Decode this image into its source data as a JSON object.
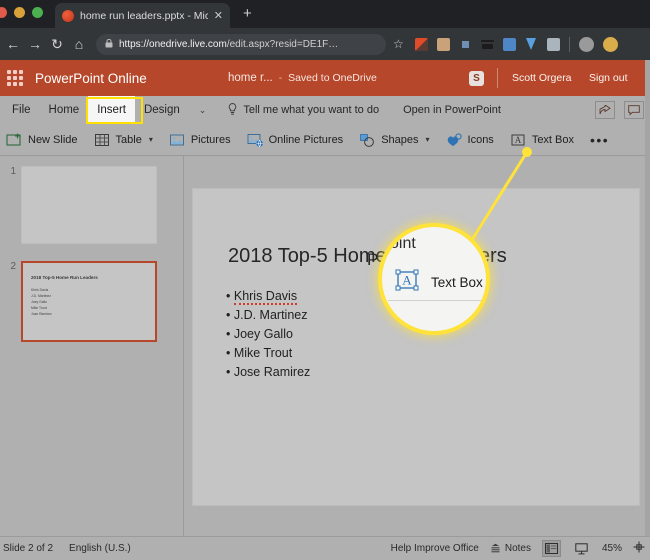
{
  "browser": {
    "tab": {
      "title": "home run leaders.pptx - Micro",
      "close_label": "✕",
      "favicon": "powerpoint-favicon"
    },
    "new_tab_label": "+",
    "nav": {
      "back": "←",
      "forward": "→",
      "reload": "↻",
      "home": "⌂"
    },
    "omnibox": {
      "lock": "🔒",
      "url_strong": "https://onedrive.live.com",
      "url_rest": "/edit.aspx?resid=DE1F…",
      "star": "☆"
    },
    "extensions": [
      "ext-pocket-icon",
      "ext-box-icon",
      "ext-square-icon",
      "ext-layers-icon",
      "ext-save-icon",
      "ext-shield-icon",
      "ext-image-icon"
    ],
    "profile_avatar": "profile-avatar",
    "second_avatar": "secondary-avatar"
  },
  "header": {
    "waffle": "app-launcher-icon",
    "brand": "PowerPoint Online",
    "doc_name": "home r...",
    "dash": "-",
    "save_state": "Saved to OneDrive",
    "skype_badge": "S",
    "user": "Scott Orgera",
    "sign_out": "Sign out",
    "accent": "#b7472a"
  },
  "ribbon": {
    "tabs": [
      {
        "label": "File",
        "active": false
      },
      {
        "label": "Home",
        "active": false
      },
      {
        "label": "Insert",
        "active": true
      },
      {
        "label": "Design",
        "active": false
      }
    ],
    "more_caret": "⌄",
    "tellme": "Tell me what you want to do",
    "tellme_icon": "lightbulb-icon",
    "open_in_powerpoint": "Open in PowerPoint",
    "share_icon": "share-icon",
    "comment_icon": "comment-icon",
    "highlight_color": "#ffe000",
    "commands": [
      {
        "label": "New Slide",
        "icon": "new-slide-icon",
        "caret": false
      },
      {
        "label": "Table",
        "icon": "table-icon",
        "caret": true
      },
      {
        "label": "Pictures",
        "icon": "pictures-icon",
        "caret": false
      },
      {
        "label": "Online Pictures",
        "icon": "online-pictures-icon",
        "caret": false
      },
      {
        "label": "Shapes",
        "icon": "shapes-icon",
        "caret": true
      },
      {
        "label": "Icons",
        "icon": "icons-icon",
        "caret": false
      },
      {
        "label": "Text Box",
        "icon": "text-box-icon",
        "caret": false
      }
    ],
    "overflow": "•••"
  },
  "thumbnails": [
    {
      "number": "1",
      "selected": false,
      "title": "",
      "bullets": []
    },
    {
      "number": "2",
      "selected": true,
      "title": "2018 Top-5 Home Run Leaders",
      "bullets": [
        "Khris Davis",
        "J.D. Martinez",
        "Joey Gallo",
        "Mike Trout",
        "Jose Ramirez"
      ]
    }
  ],
  "slide": {
    "title": "2018 Top-5 Home Run Leaders",
    "bullets": [
      {
        "text": "Khris Davis",
        "misspelled": true
      },
      {
        "text": "J.D. Martinez",
        "misspelled": false
      },
      {
        "text": "Joey Gallo",
        "misspelled": false
      },
      {
        "text": "Mike Trout",
        "misspelled": false
      },
      {
        "text": "Jose Ramirez",
        "misspelled": false
      }
    ]
  },
  "callout": {
    "ghost_text": "oint",
    "ghost_left": "P",
    "label": "Text Box",
    "icon": "text-box-icon",
    "ring_color": "#ffe23a"
  },
  "statusbar": {
    "slide_count": "Slide 2 of 2",
    "language": "English (U.S.)",
    "help": "Help Improve Office",
    "notes_icon": "notes-icon",
    "notes": "Notes",
    "view_normal_icon": "normal-view-icon",
    "view_slideshow_icon": "slideshow-view-icon",
    "zoom": "45%",
    "fit_icon": "fit-slide-icon"
  }
}
